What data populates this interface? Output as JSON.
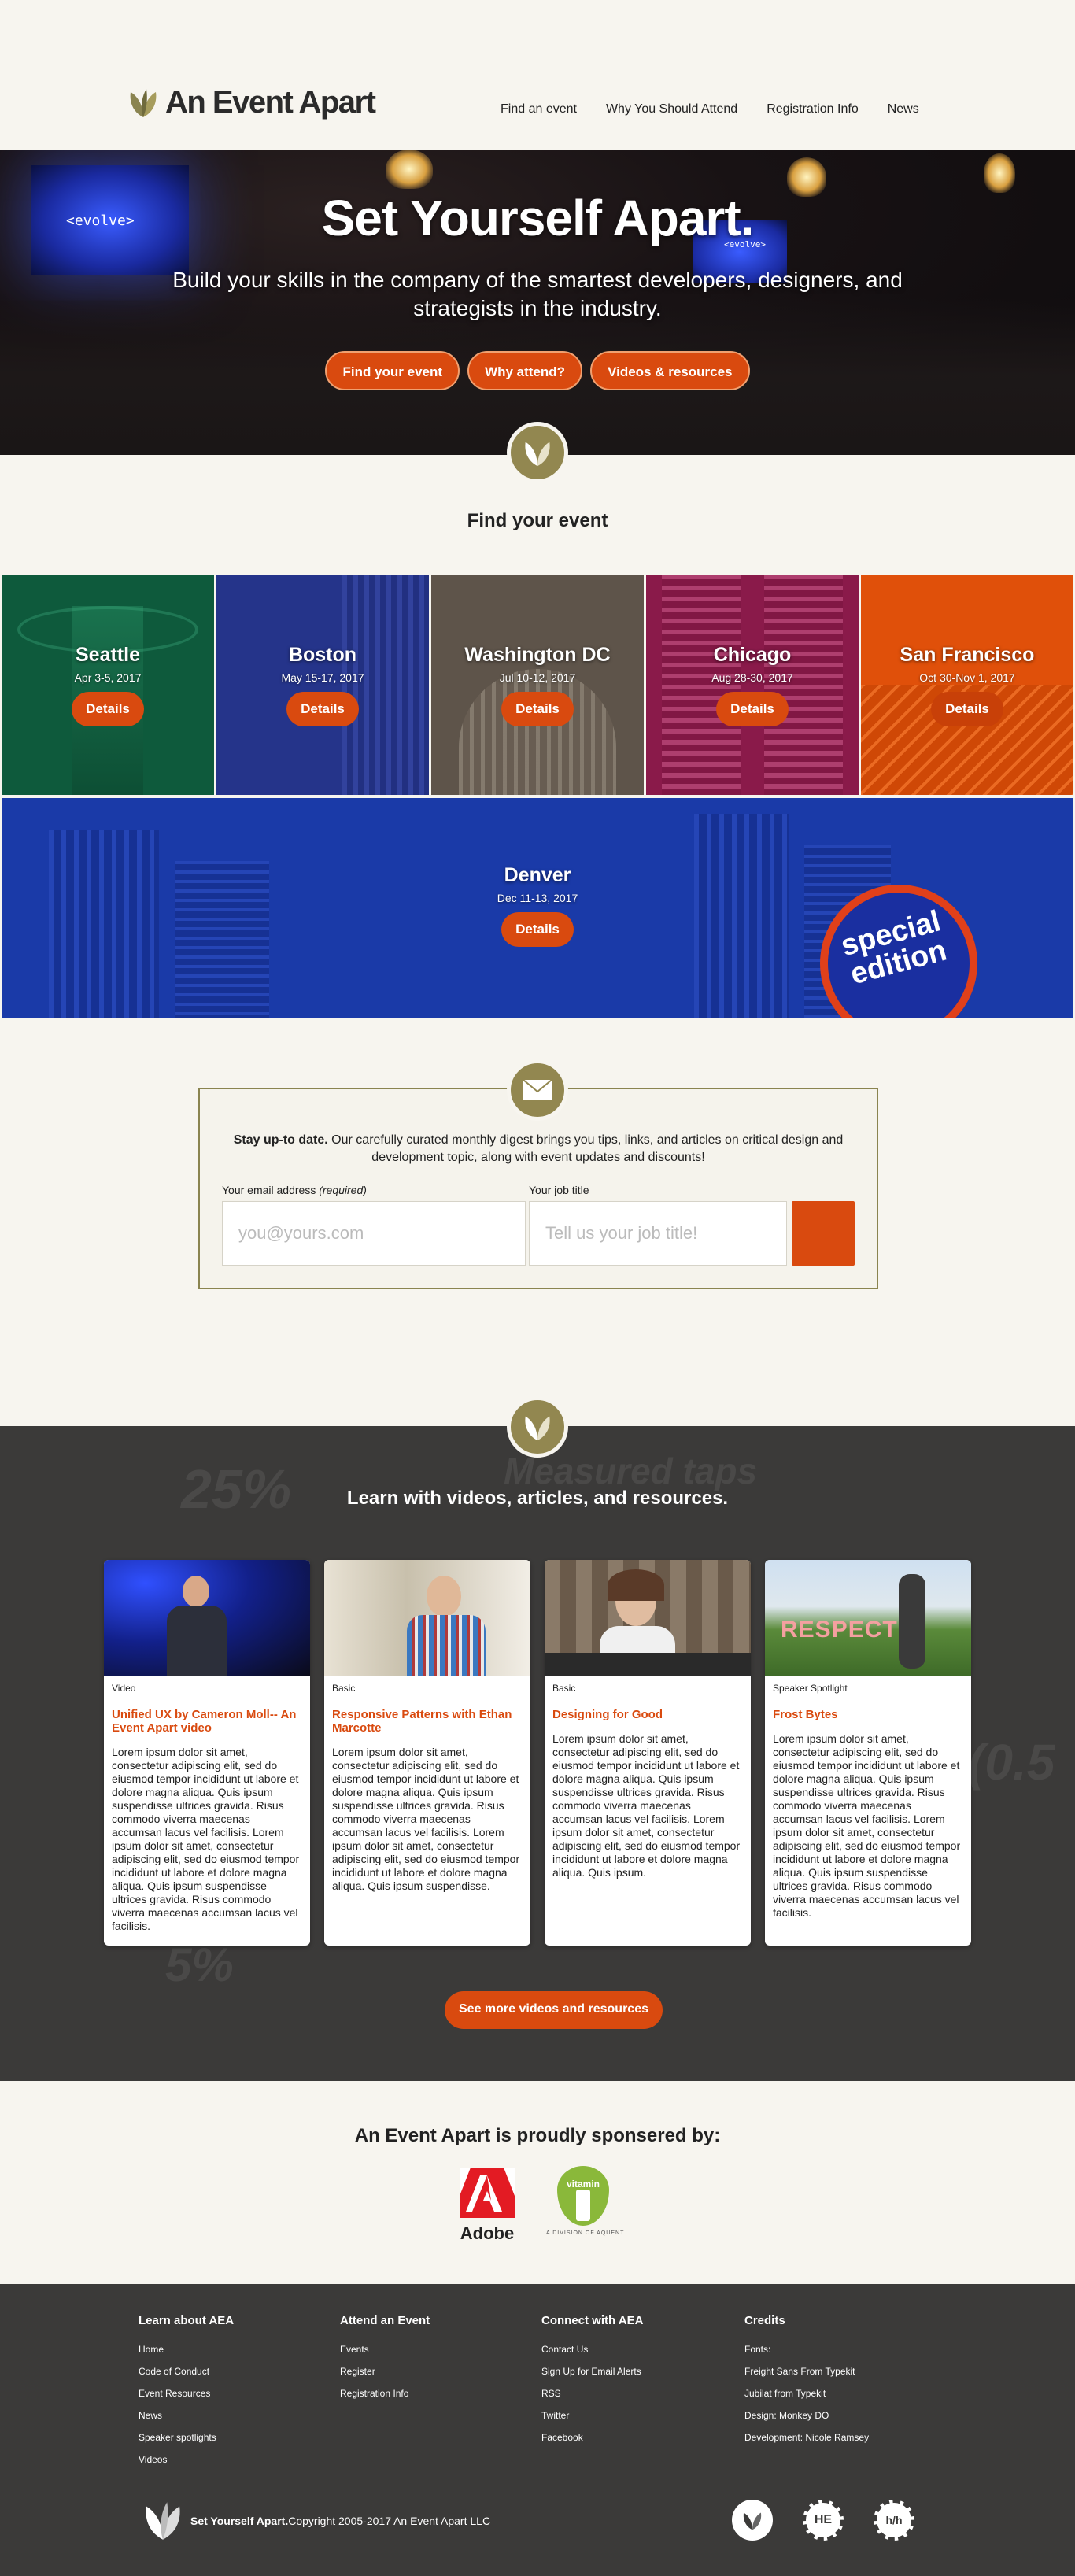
{
  "brand": {
    "name": "An Event Apart"
  },
  "nav": [
    "Find an event",
    "Why You Should Attend",
    "Registration Info",
    "News"
  ],
  "hero": {
    "screen_text": "<evolve>",
    "title": "Set Yourself Apart.",
    "subtitle": "Build your skills in the company of the smartest developers, designers, and strategists in the industry.",
    "buttons": [
      "Find your event",
      "Why attend?",
      "Videos & resources"
    ]
  },
  "events": {
    "title": "Find your event",
    "details_label": "Details",
    "items": [
      {
        "city": "Seattle",
        "date": "Apr 3-5, 2017",
        "color": "#0e5a3c"
      },
      {
        "city": "Boston",
        "date": "May 15-17, 2017",
        "color": "#25348a"
      },
      {
        "city": "Washington DC",
        "date": "Jul 10-12, 2017",
        "color": "#5e544a"
      },
      {
        "city": "Chicago",
        "date": "Aug 28-30, 2017",
        "color": "#8a1a4a"
      },
      {
        "city": "San Francisco",
        "date": "Oct 30-Nov 1, 2017",
        "color": "#e0500a"
      }
    ],
    "featured": {
      "city": "Denver",
      "date": "Dec 11-13, 2017",
      "badge_line1": "special",
      "badge_line2": "edition",
      "color": "#1a3aa8"
    }
  },
  "newsletter": {
    "lead": "Stay up-to date.",
    "text": " Our carefully curated monthly digest brings you tips, links, and articles on critical design and development topic, along with event updates and discounts!",
    "email_label": "Your email address",
    "email_required": "(required)",
    "email_placeholder": "you@yours.com",
    "job_label": "Your job title",
    "job_placeholder": "Tell us your job title!"
  },
  "learn": {
    "title": "Learn with videos, articles, and resources.",
    "ghost": [
      "25%",
      "Measured taps",
      "5%",
      "(0.5"
    ],
    "cards": [
      {
        "tag": "Video",
        "title": "Unified UX by Cameron Moll-- An Event Apart video",
        "body": "Lorem ipsum dolor sit amet, consectetur adipiscing elit, sed do eiusmod tempor incididunt ut labore et dolore magna aliqua. Quis ipsum suspendisse ultrices gravida. Risus commodo viverra maecenas accumsan lacus vel facilisis. Lorem ipsum dolor sit amet, consectetur adipiscing elit, sed do eiusmod tempor incididunt ut labore et dolore magna aliqua. Quis ipsum suspendisse ultrices gravida. Risus commodo viverra maecenas accumsan lacus vel facilisis."
      },
      {
        "tag": "Basic",
        "title": "Responsive Patterns with Ethan Marcotte",
        "body": "Lorem ipsum dolor sit amet, consectetur adipiscing elit, sed do eiusmod tempor incididunt ut labore et dolore magna aliqua. Quis ipsum suspendisse ultrices gravida. Risus commodo viverra maecenas accumsan lacus vel facilisis. Lorem ipsum dolor sit amet, consectetur adipiscing elit, sed do eiusmod tempor incididunt ut labore et dolore magna aliqua. Quis ipsum suspendisse."
      },
      {
        "tag": "Basic",
        "title": "Designing for Good",
        "body": "Lorem ipsum dolor sit amet, consectetur adipiscing elit, sed do eiusmod tempor incididunt ut labore et dolore magna aliqua. Quis ipsum suspendisse ultrices gravida. Risus commodo viverra maecenas accumsan lacus vel facilisis. Lorem ipsum dolor sit amet, consectetur adipiscing elit, sed do eiusmod tempor incididunt ut labore et dolore magna aliqua. Quis ipsum."
      },
      {
        "tag": "Speaker Spotlight",
        "title": "Frost Bytes",
        "body": "Lorem ipsum dolor sit amet, consectetur adipiscing elit, sed do eiusmod tempor incididunt ut labore et dolore magna aliqua. Quis ipsum suspendisse ultrices gravida. Risus commodo viverra maecenas accumsan lacus vel facilisis. Lorem ipsum dolor sit amet, consectetur adipiscing elit, sed do eiusmod tempor incididunt ut labore et dolore magna aliqua. Quis ipsum suspendisse ultrices gravida. Risus commodo viverra maecenas accumsan lacus vel facilisis."
      }
    ],
    "respect_text": "RESPECT",
    "more_button": "See more videos and resources"
  },
  "sponsors": {
    "title": "An Event Apart is proudly sponsered by:",
    "adobe": "Adobe",
    "vitamin": "vitamin",
    "aquent": "A DIVISION OF AQUENT"
  },
  "footer": {
    "columns": [
      {
        "title": "Learn about AEA",
        "links": [
          "Home",
          "Code of Conduct",
          "Event Resources",
          "News",
          "Speaker spotlights",
          "Videos"
        ]
      },
      {
        "title": "Attend an Event",
        "links": [
          "Events",
          "Register",
          "Registration Info"
        ]
      },
      {
        "title": "Connect with AEA",
        "links": [
          "Contact Us",
          "Sign Up for Email Alerts",
          "RSS",
          "Twitter",
          "Facebook"
        ]
      },
      {
        "title": "Credits",
        "links": [
          "Fonts:",
          "Freight Sans From Typekit",
          "Jubilat from Typekit",
          "Design: Monkey DO",
          "Development: Nicole Ramsey"
        ]
      }
    ],
    "tagline": "Set Yourself Apart.",
    "copyright": " Copyright 2005-2017 An Event Apart LLC",
    "icon_labels": [
      "HE",
      "h/h"
    ]
  }
}
